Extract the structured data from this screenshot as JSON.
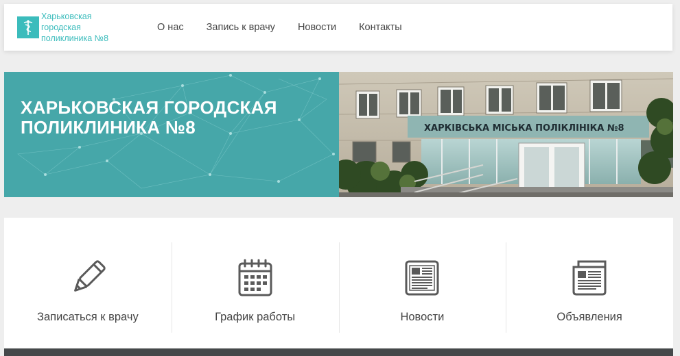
{
  "brand": {
    "name_line1": "Харьковская городская",
    "name_line2": "поликлиника №8",
    "accent_color": "#3bbcbc",
    "icon": "caduceus-icon"
  },
  "nav": {
    "items": [
      {
        "label": "О нас"
      },
      {
        "label": "Запись к врачу"
      },
      {
        "label": "Новости"
      },
      {
        "label": "Контакты"
      }
    ]
  },
  "hero": {
    "title": "ХАРЬКОВСКАЯ ГОРОДСКАЯ ПОЛИКЛИНИКА №8",
    "panel_color": "#46a7a9",
    "building_sign": "ХАРКІВСЬКА МІСЬКА ПОЛІКЛІНІКА №8"
  },
  "cards": [
    {
      "label": "Записаться к врачу",
      "icon": "pencil-icon"
    },
    {
      "label": "График работы",
      "icon": "calendar-icon"
    },
    {
      "label": "Новости",
      "icon": "newspaper-icon"
    },
    {
      "label": "Объявления",
      "icon": "announcement-icon"
    }
  ]
}
